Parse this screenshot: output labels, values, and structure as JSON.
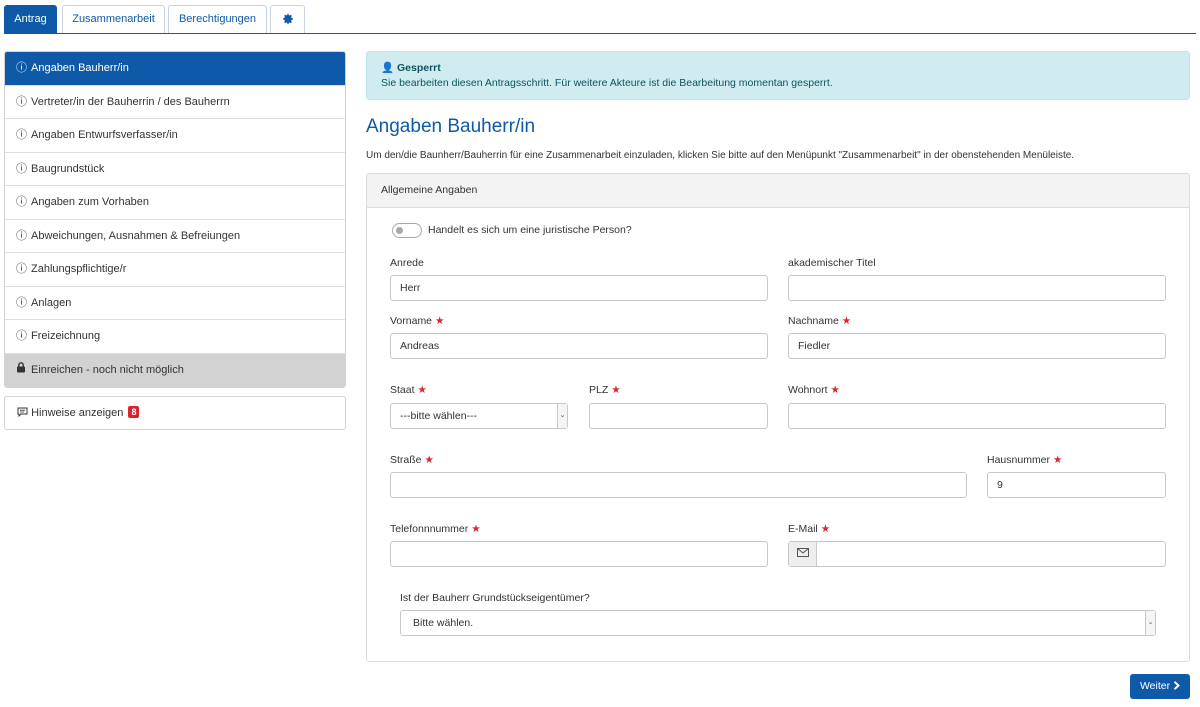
{
  "tabs": [
    {
      "label": "Antrag",
      "active": true
    },
    {
      "label": "Zusammenarbeit",
      "active": false
    },
    {
      "label": "Berechtigungen",
      "active": false
    }
  ],
  "sidebar": {
    "items": [
      {
        "label": "Angaben Bauherr/in",
        "icon": "exclamation-circle-icon"
      },
      {
        "label": "Vertreter/in der Bauherrin / des Bauherrn",
        "icon": "exclamation-circle-icon"
      },
      {
        "label": "Angaben Entwurfsverfasser/in",
        "icon": "exclamation-circle-icon"
      },
      {
        "label": "Baugrundstück",
        "icon": "exclamation-circle-icon"
      },
      {
        "label": "Angaben zum Vorhaben",
        "icon": "exclamation-circle-icon"
      },
      {
        "label": "Abweichungen, Ausnahmen & Befreiungen",
        "icon": "exclamation-circle-icon"
      },
      {
        "label": "Zahlungspflichtige/r",
        "icon": "exclamation-circle-icon"
      },
      {
        "label": "Anlagen",
        "icon": "exclamation-circle-icon"
      },
      {
        "label": "Freizeichnung",
        "icon": "exclamation-circle-icon"
      },
      {
        "label": "Einreichen - noch nicht möglich",
        "icon": "lock-icon"
      }
    ],
    "hints_label": "Hinweise anzeigen",
    "hints_count": "8"
  },
  "alert": {
    "title": "Gesperrt",
    "text": "Sie bearbeiten diesen Antragsschritt. Für weitere Akteure ist die Bearbeitung momentan gesperrt."
  },
  "page": {
    "title": "Angaben Bauherr/in",
    "intro": "Um den/die Baunherr/Bauherrin für eine Zusammenarbeit einzuladen, klicken Sie bitte auf den Menüpunkt \"Zusammenarbeit\" in der obenstehenden Menüleiste."
  },
  "form": {
    "section_title": "Allgemeine Angaben",
    "toggle_label": "Handelt es sich um eine juristische Person?",
    "anrede": {
      "label": "Anrede",
      "value": "Herr"
    },
    "titel": {
      "label": "akademischer Titel",
      "value": ""
    },
    "vorname": {
      "label": "Vorname",
      "value": "Andreas"
    },
    "nachname": {
      "label": "Nachname",
      "value": "Fiedler"
    },
    "staat": {
      "label": "Staat",
      "value": "---bitte wählen---"
    },
    "plz": {
      "label": "PLZ",
      "value": ""
    },
    "wohnort": {
      "label": "Wohnort",
      "value": ""
    },
    "strasse": {
      "label": "Straße",
      "value": ""
    },
    "hausnummer": {
      "label": "Hausnummer",
      "value": "9"
    },
    "telefon": {
      "label": "Telefonnnummer",
      "value": ""
    },
    "email": {
      "label": "E-Mail",
      "value": ""
    },
    "eigentuemer": {
      "label": "Ist der Bauherr Grundstückseigentümer?",
      "value": "Bitte wählen."
    },
    "required_mark": "★"
  },
  "buttons": {
    "next": "Weiter"
  },
  "colors": {
    "primary": "#0f5aa8",
    "required": "#d9262e",
    "alert_bg": "#d1ecf1"
  }
}
